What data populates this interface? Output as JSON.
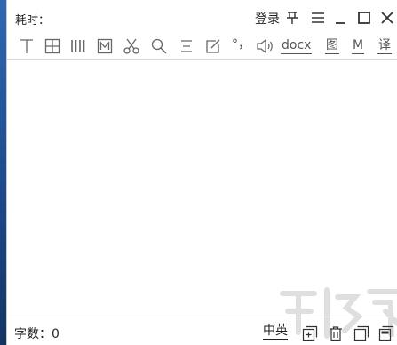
{
  "title_bar": {
    "time_label": "耗时：",
    "login_label": "登录",
    "controls": [
      "pin-icon",
      "menu-icon",
      "minimize-icon",
      "maximize-icon",
      "close-icon"
    ]
  },
  "toolbar": {
    "icons": [
      "text-cursor-icon",
      "table-grid-icon",
      "columns-icon",
      "markdown-box-icon",
      "scissors-icon",
      "search-icon",
      "align-lines-icon",
      "edit-icon",
      "punctuation-icon",
      "speaker-icon"
    ],
    "punctuation_glyph": "°，",
    "docx_label": "docx",
    "image_label": "图",
    "m_label": "M",
    "translate_label": "译"
  },
  "status_bar": {
    "word_count_label": "字数：0",
    "language_label": "中英",
    "actions": [
      "new-doc-icon",
      "delete-icon",
      "copy-icon",
      "window-icon"
    ]
  },
  "colors": {
    "icon": "#666666",
    "text": "#222222",
    "desktop": "#1a3f73"
  }
}
